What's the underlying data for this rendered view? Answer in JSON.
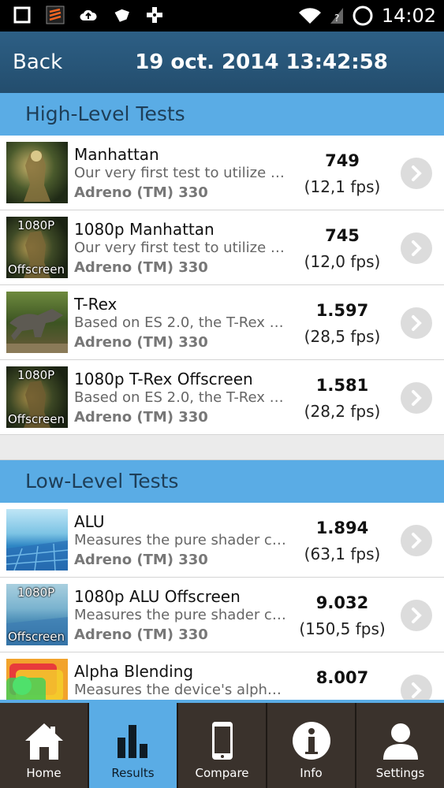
{
  "status": {
    "time": "14:02"
  },
  "header": {
    "back_label": "Back",
    "title": "19 oct. 2014 13:42:58"
  },
  "sections": [
    {
      "title": "High-Level Tests",
      "items": [
        {
          "name": "Manhattan",
          "desc": "Our very first test to utilize th...",
          "device": "Adreno (TM) 330",
          "score": "749",
          "fps": "(12,1 fps)",
          "thumb": "manhattan",
          "tag_top": "",
          "tag_bottom": ""
        },
        {
          "name": "1080p Manhattan",
          "desc": "Our very first test to utilize th...",
          "device": "Adreno (TM) 330",
          "score": "745",
          "fps": "(12,0 fps)",
          "thumb": "manhattan",
          "tag_top": "1080P",
          "tag_bottom": "Offscreen"
        },
        {
          "name": "T-Rex",
          "desc": "Based on ES 2.0, the T-Rex te...",
          "device": "Adreno (TM) 330",
          "score": "1.597",
          "fps": "(28,5 fps)",
          "thumb": "trex",
          "tag_top": "",
          "tag_bottom": ""
        },
        {
          "name": "1080p T-Rex Offscreen",
          "desc": "Based on ES 2.0, the T-Rex te...",
          "device": "Adreno (TM) 330",
          "score": "1.581",
          "fps": "(28,2 fps)",
          "thumb": "manhattan",
          "tag_top": "1080P",
          "tag_bottom": "Offscreen"
        }
      ]
    },
    {
      "title": "Low-Level Tests",
      "items": [
        {
          "name": "ALU",
          "desc": "Measures the pure shader co...",
          "device": "Adreno (TM) 330",
          "score": "1.894",
          "fps": "(63,1 fps)",
          "thumb": "alu",
          "tag_top": "",
          "tag_bottom": ""
        },
        {
          "name": "1080p ALU Offscreen",
          "desc": "Measures the pure shader co...",
          "device": "Adreno (TM) 330",
          "score": "9.032",
          "fps": "(150,5 fps)",
          "thumb": "alu",
          "tag_top": "1080P",
          "tag_bottom": "Offscreen"
        },
        {
          "name": "Alpha Blending",
          "desc": "Measures the device's alpha b...",
          "device": "",
          "score": "8.007",
          "fps": "",
          "thumb": "alpha",
          "tag_top": "",
          "tag_bottom": ""
        }
      ]
    }
  ],
  "nav": [
    {
      "label": "Home",
      "icon": "home-icon",
      "active": false
    },
    {
      "label": "Results",
      "icon": "results-icon",
      "active": true
    },
    {
      "label": "Compare",
      "icon": "phone-icon",
      "active": false
    },
    {
      "label": "Info",
      "icon": "info-icon",
      "active": false
    },
    {
      "label": "Settings",
      "icon": "user-icon",
      "active": false
    }
  ]
}
